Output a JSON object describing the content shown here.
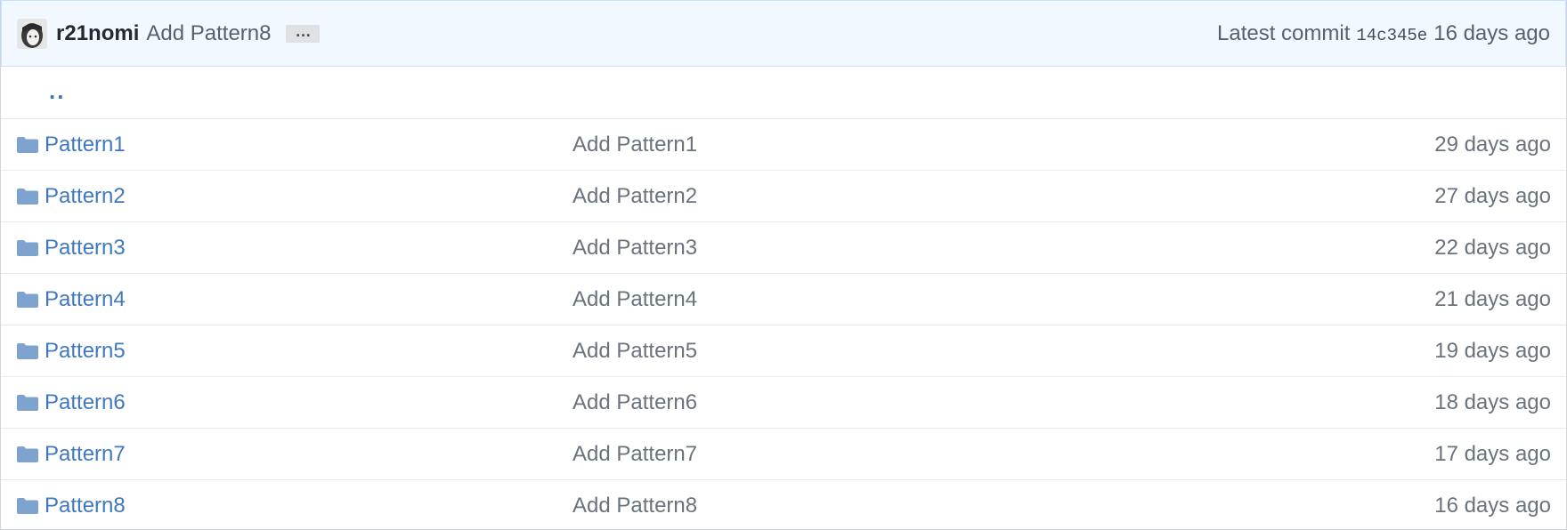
{
  "commit": {
    "author": "r21nomi",
    "message": "Add Pattern8",
    "ellipsis": "…",
    "latest_label": "Latest commit",
    "sha": "14c345e",
    "age": "16 days ago"
  },
  "up_tree": "..",
  "colors": {
    "link": "#4078c0",
    "folder": "#7ea3cf",
    "header_bg": "#f1f8ff"
  },
  "files": [
    {
      "name": "Pattern1",
      "message": "Add Pattern1",
      "age": "29 days ago",
      "icon": "folder-icon"
    },
    {
      "name": "Pattern2",
      "message": "Add Pattern2",
      "age": "27 days ago",
      "icon": "folder-icon"
    },
    {
      "name": "Pattern3",
      "message": "Add Pattern3",
      "age": "22 days ago",
      "icon": "folder-icon"
    },
    {
      "name": "Pattern4",
      "message": "Add Pattern4",
      "age": "21 days ago",
      "icon": "folder-icon"
    },
    {
      "name": "Pattern5",
      "message": "Add Pattern5",
      "age": "19 days ago",
      "icon": "folder-icon"
    },
    {
      "name": "Pattern6",
      "message": "Add Pattern6",
      "age": "18 days ago",
      "icon": "folder-icon"
    },
    {
      "name": "Pattern7",
      "message": "Add Pattern7",
      "age": "17 days ago",
      "icon": "folder-icon"
    },
    {
      "name": "Pattern8",
      "message": "Add Pattern8",
      "age": "16 days ago",
      "icon": "folder-icon"
    }
  ]
}
